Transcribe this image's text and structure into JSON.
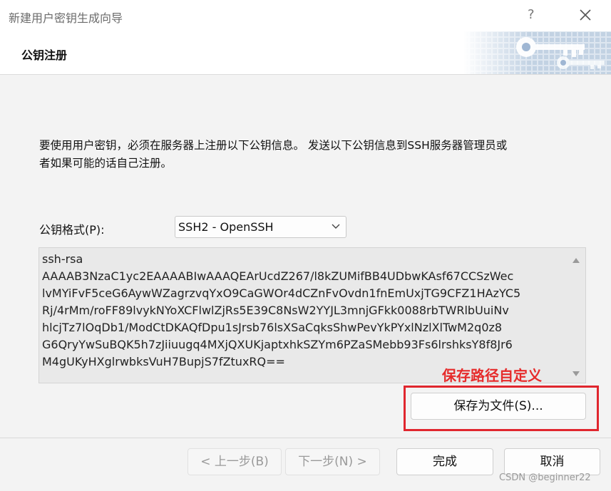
{
  "window": {
    "title": "新建用户密钥生成向导",
    "help_glyph": "?",
    "close_icon": "close-icon"
  },
  "header": {
    "title": "公钥注册",
    "art_icon": "keys-icon"
  },
  "content": {
    "description": "要使用用户密钥，必须在服务器上注册以下公钥信息。 发送以下公钥信息到SSH服务器管理员或\n者如果可能的话自己注册。",
    "format_label": "公钥格式(P):",
    "format_value": "SSH2 - OpenSSH",
    "public_key_text": "ssh-rsa\nAAAAB3NzaC1yc2EAAAABIwAAAQEArUcdZ267/l8kZUMifBB4UDbwKAsf67CCSzWec\nlvMYiFvF5ceG6AywWZagrzvqYxO9CaGWOr4dCZnFvOvdn1fnEmUxjTG9CFZ1HAzYC5\nRj/4rMm/roFF89lvykNYoXCFlwlZjRs5E39C8NsW2YYJL3mnjGFkk0088rbTWRlbUuiNv\nhlcjTz7lOqDb1/ModCtDKAQfDpu1sJrsb76lsXSaCqksShwPevYkPYxlNzlXlTwM2q0z8\nG6QryYwSuBQK5h7zJiiuugq4MXjQXUKjaptxhkSZYm6PZaSMebb93Fs6lrshksY8f8Jr6\nM4gUKyHXglrwbksVuH7BupjS7fZtuxRQ==",
    "annotation": "保存路径自定义",
    "save_button": "保存为文件(S)..."
  },
  "footer": {
    "back_button": "< 上一步(B)",
    "next_button": "下一步(N) >",
    "finish_button": "完成",
    "cancel_button": "取消"
  },
  "watermark": "CSDN @beginner22",
  "colors": {
    "annotation_red": "#e62b2b",
    "disabled_text": "#9a9a9a",
    "key_art_blue": "#8aa6c8"
  }
}
